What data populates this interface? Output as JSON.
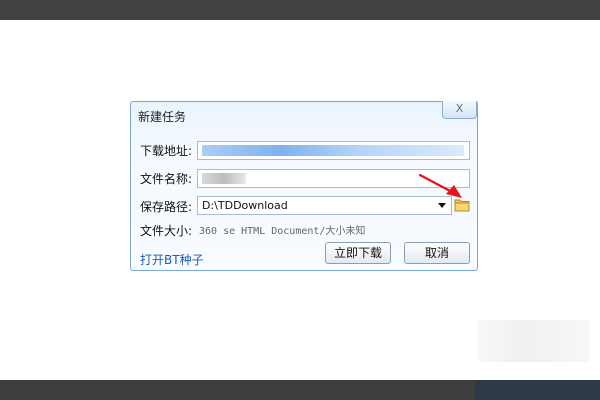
{
  "dialog": {
    "title": "新建任务",
    "close_label": "X",
    "fields": {
      "url_label": "下载地址:",
      "name_label": "文件名称:",
      "path_label": "保存路径:",
      "path_value": "D:\\TDDownload",
      "size_label": "文件大小:",
      "size_value": "360 se HTML Document/大小未知"
    },
    "open_bt_label": "打开BT种子",
    "download_label": "立即下载",
    "cancel_label": "取消"
  },
  "colors": {
    "accent": "#1560b8",
    "border": "#7aa7d6",
    "arrow": "#e8131a"
  },
  "icons": {
    "close": "close-icon",
    "folder": "folder-icon",
    "dropdown": "chevron-down-icon",
    "annotation": "red-arrow-icon"
  }
}
